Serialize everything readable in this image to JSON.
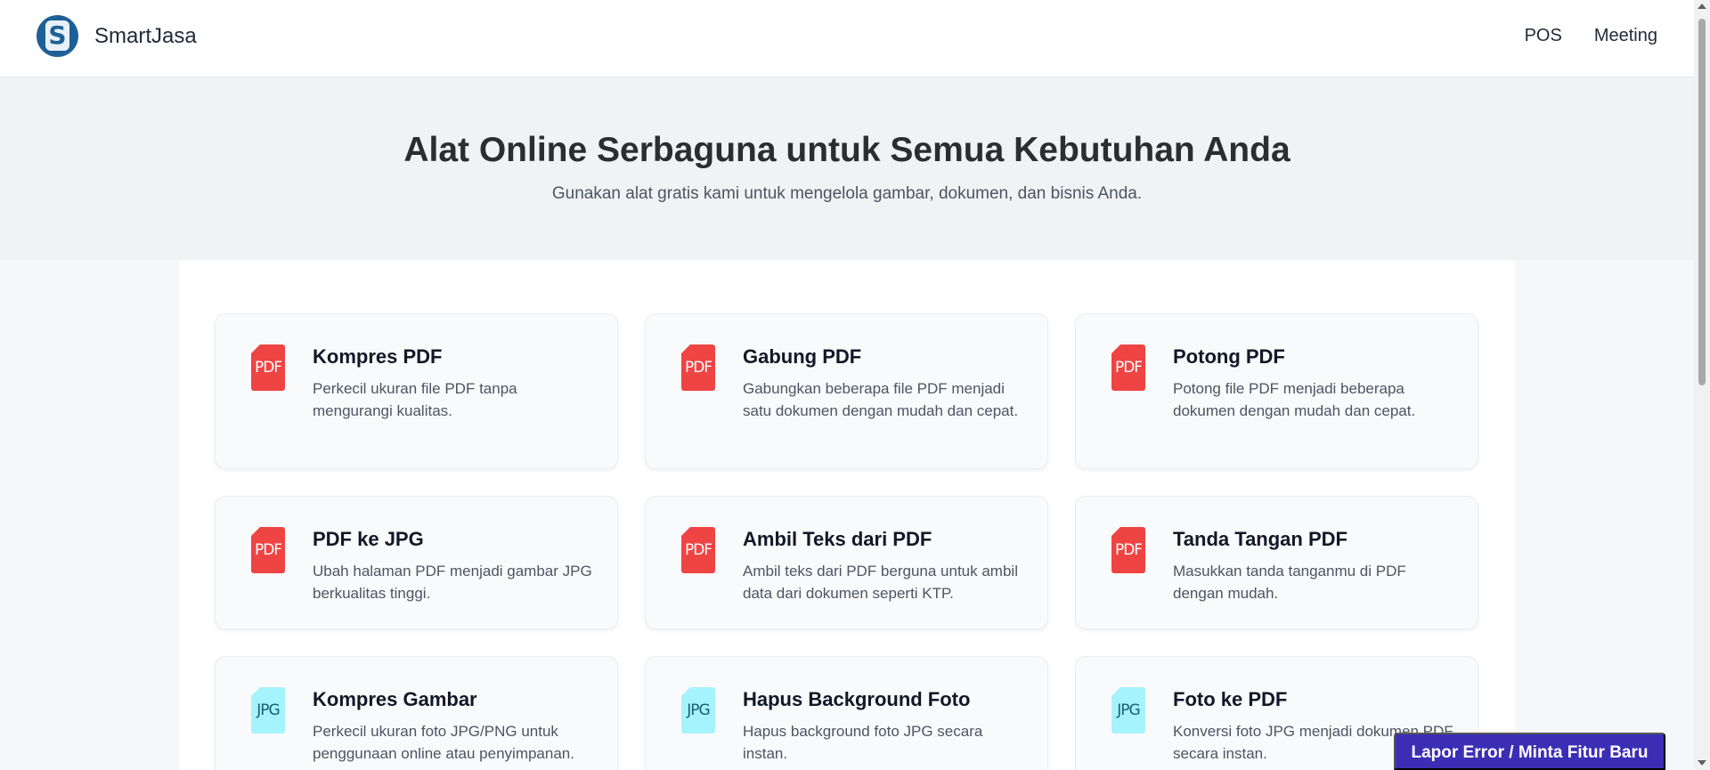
{
  "brand": {
    "name": "SmartJasa",
    "logo_letter": "S"
  },
  "nav": {
    "items": [
      "POS",
      "Meeting"
    ]
  },
  "hero": {
    "title": "Alat Online Serbaguna untuk Semua Kebutuhan Anda",
    "subtitle": "Gunakan alat gratis kami untuk mengelola gambar, dokumen, dan bisnis Anda."
  },
  "tools": [
    {
      "icon": "pdf-file-icon",
      "icon_label": "PDF",
      "title": "Kompres PDF",
      "description": "Perkecil ukuran file PDF tanpa mengurangi kualitas."
    },
    {
      "icon": "pdf-file-icon",
      "icon_label": "PDF",
      "title": "Gabung PDF",
      "description": "Gabungkan beberapa file PDF menjadi satu dokumen dengan mudah dan cepat."
    },
    {
      "icon": "pdf-file-icon",
      "icon_label": "PDF",
      "title": "Potong PDF",
      "description": "Potong file PDF menjadi beberapa dokumen dengan mudah dan cepat."
    },
    {
      "icon": "pdf-file-icon",
      "icon_label": "PDF",
      "title": "PDF ke JPG",
      "description": "Ubah halaman PDF menjadi gambar JPG berkualitas tinggi."
    },
    {
      "icon": "pdf-file-icon",
      "icon_label": "PDF",
      "title": "Ambil Teks dari PDF",
      "description": "Ambil teks dari PDF berguna untuk ambil data dari dokumen seperti KTP."
    },
    {
      "icon": "pdf-file-icon",
      "icon_label": "PDF",
      "title": "Tanda Tangan PDF",
      "description": "Masukkan tanda tanganmu di PDF dengan mudah."
    },
    {
      "icon": "jpg-file-icon",
      "icon_label": "JPG",
      "title": "Kompres Gambar",
      "description": "Perkecil ukuran foto JPG/PNG untuk penggunaan online atau penyimpanan."
    },
    {
      "icon": "jpg-file-icon",
      "icon_label": "JPG",
      "title": "Hapus Background Foto",
      "description": "Hapus background foto JPG secara instan."
    },
    {
      "icon": "jpg-file-icon",
      "icon_label": "JPG",
      "title": "Foto ke PDF",
      "description": "Konversi foto JPG menjadi dokumen PDF secara instan."
    }
  ],
  "feedback_button": "Lapor Error / Minta Fitur Baru",
  "colors": {
    "brand_blue": "#1e6096",
    "pdf_red": "#ef4444",
    "jpg_cyan": "#a5f3fc",
    "feedback_purple": "#3b2eb5"
  }
}
